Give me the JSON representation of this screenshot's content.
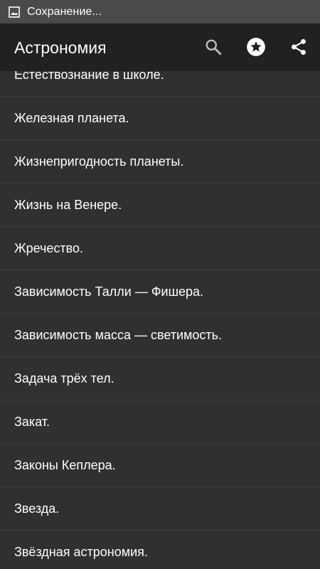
{
  "status_bar": {
    "icon": "image-icon",
    "text": "Сохранение..."
  },
  "app_bar": {
    "title": "Астрономия",
    "actions": [
      {
        "name": "search",
        "icon": "search-icon"
      },
      {
        "name": "favorite",
        "icon": "star-circle-icon"
      },
      {
        "name": "share",
        "icon": "share-icon"
      }
    ]
  },
  "colors": {
    "status_bar_bg": "#4a4a4a",
    "app_bar_bg": "#212121",
    "list_bg": "#303030",
    "divider": "#3e3e3e",
    "text": "#ffffff"
  },
  "list": {
    "items": [
      "Естествознание в школе.",
      "Железная планета.",
      "Жизнепригодность планеты.",
      "Жизнь на Венере.",
      "Жречество.",
      "Зависимость Талли — Фишера.",
      "Зависимость масса — светимость.",
      "Задача трёх тел.",
      "Закат.",
      "Законы Кеплера.",
      "Звезда.",
      "Звёздная астрономия."
    ]
  }
}
